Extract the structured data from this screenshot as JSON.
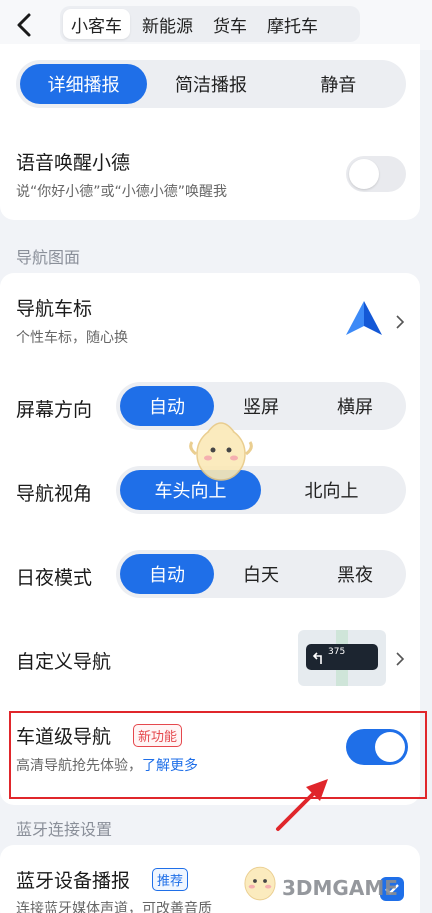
{
  "vehicle_tabs": [
    "小客车",
    "新能源",
    "货车",
    "摩托车"
  ],
  "broadcast": {
    "options": [
      "详细播报",
      "简洁播报",
      "静音"
    ],
    "selected": "详细播报"
  },
  "wake": {
    "title": "语音唤醒小德",
    "subtitle": "说“你好小德”或“小德小德”唤醒我",
    "enabled": false
  },
  "section_nav_map": "导航图面",
  "car_icon": {
    "title": "导航车标",
    "subtitle": "个性车标，随心换"
  },
  "screen_orientation": {
    "title": "屏幕方向",
    "options": [
      "自动",
      "竖屏",
      "横屏"
    ],
    "selected": "自动"
  },
  "nav_view": {
    "title": "导航视角",
    "options": [
      "车头向上",
      "北向上"
    ],
    "selected": "车头向上"
  },
  "day_night": {
    "title": "日夜模式",
    "options": [
      "自动",
      "白天",
      "黑夜"
    ],
    "selected": "自动"
  },
  "custom_nav": {
    "title": "自定义导航",
    "preview_number": "375"
  },
  "lane_nav": {
    "title": "车道级导航",
    "badge": "新功能",
    "subtitle": "高清导航抢先体验，",
    "link": "了解更多",
    "enabled": true
  },
  "section_bluetooth": "蓝牙连接设置",
  "bluetooth": {
    "title": "蓝牙设备播报",
    "badge": "推荐",
    "subtitle": "连接蓝牙媒体声道，可改善音质"
  },
  "watermark": "3DMGAME",
  "colors": {
    "accent": "#1f6fe8",
    "highlight_border": "#e0262b",
    "badge_new": "#e5484d"
  }
}
